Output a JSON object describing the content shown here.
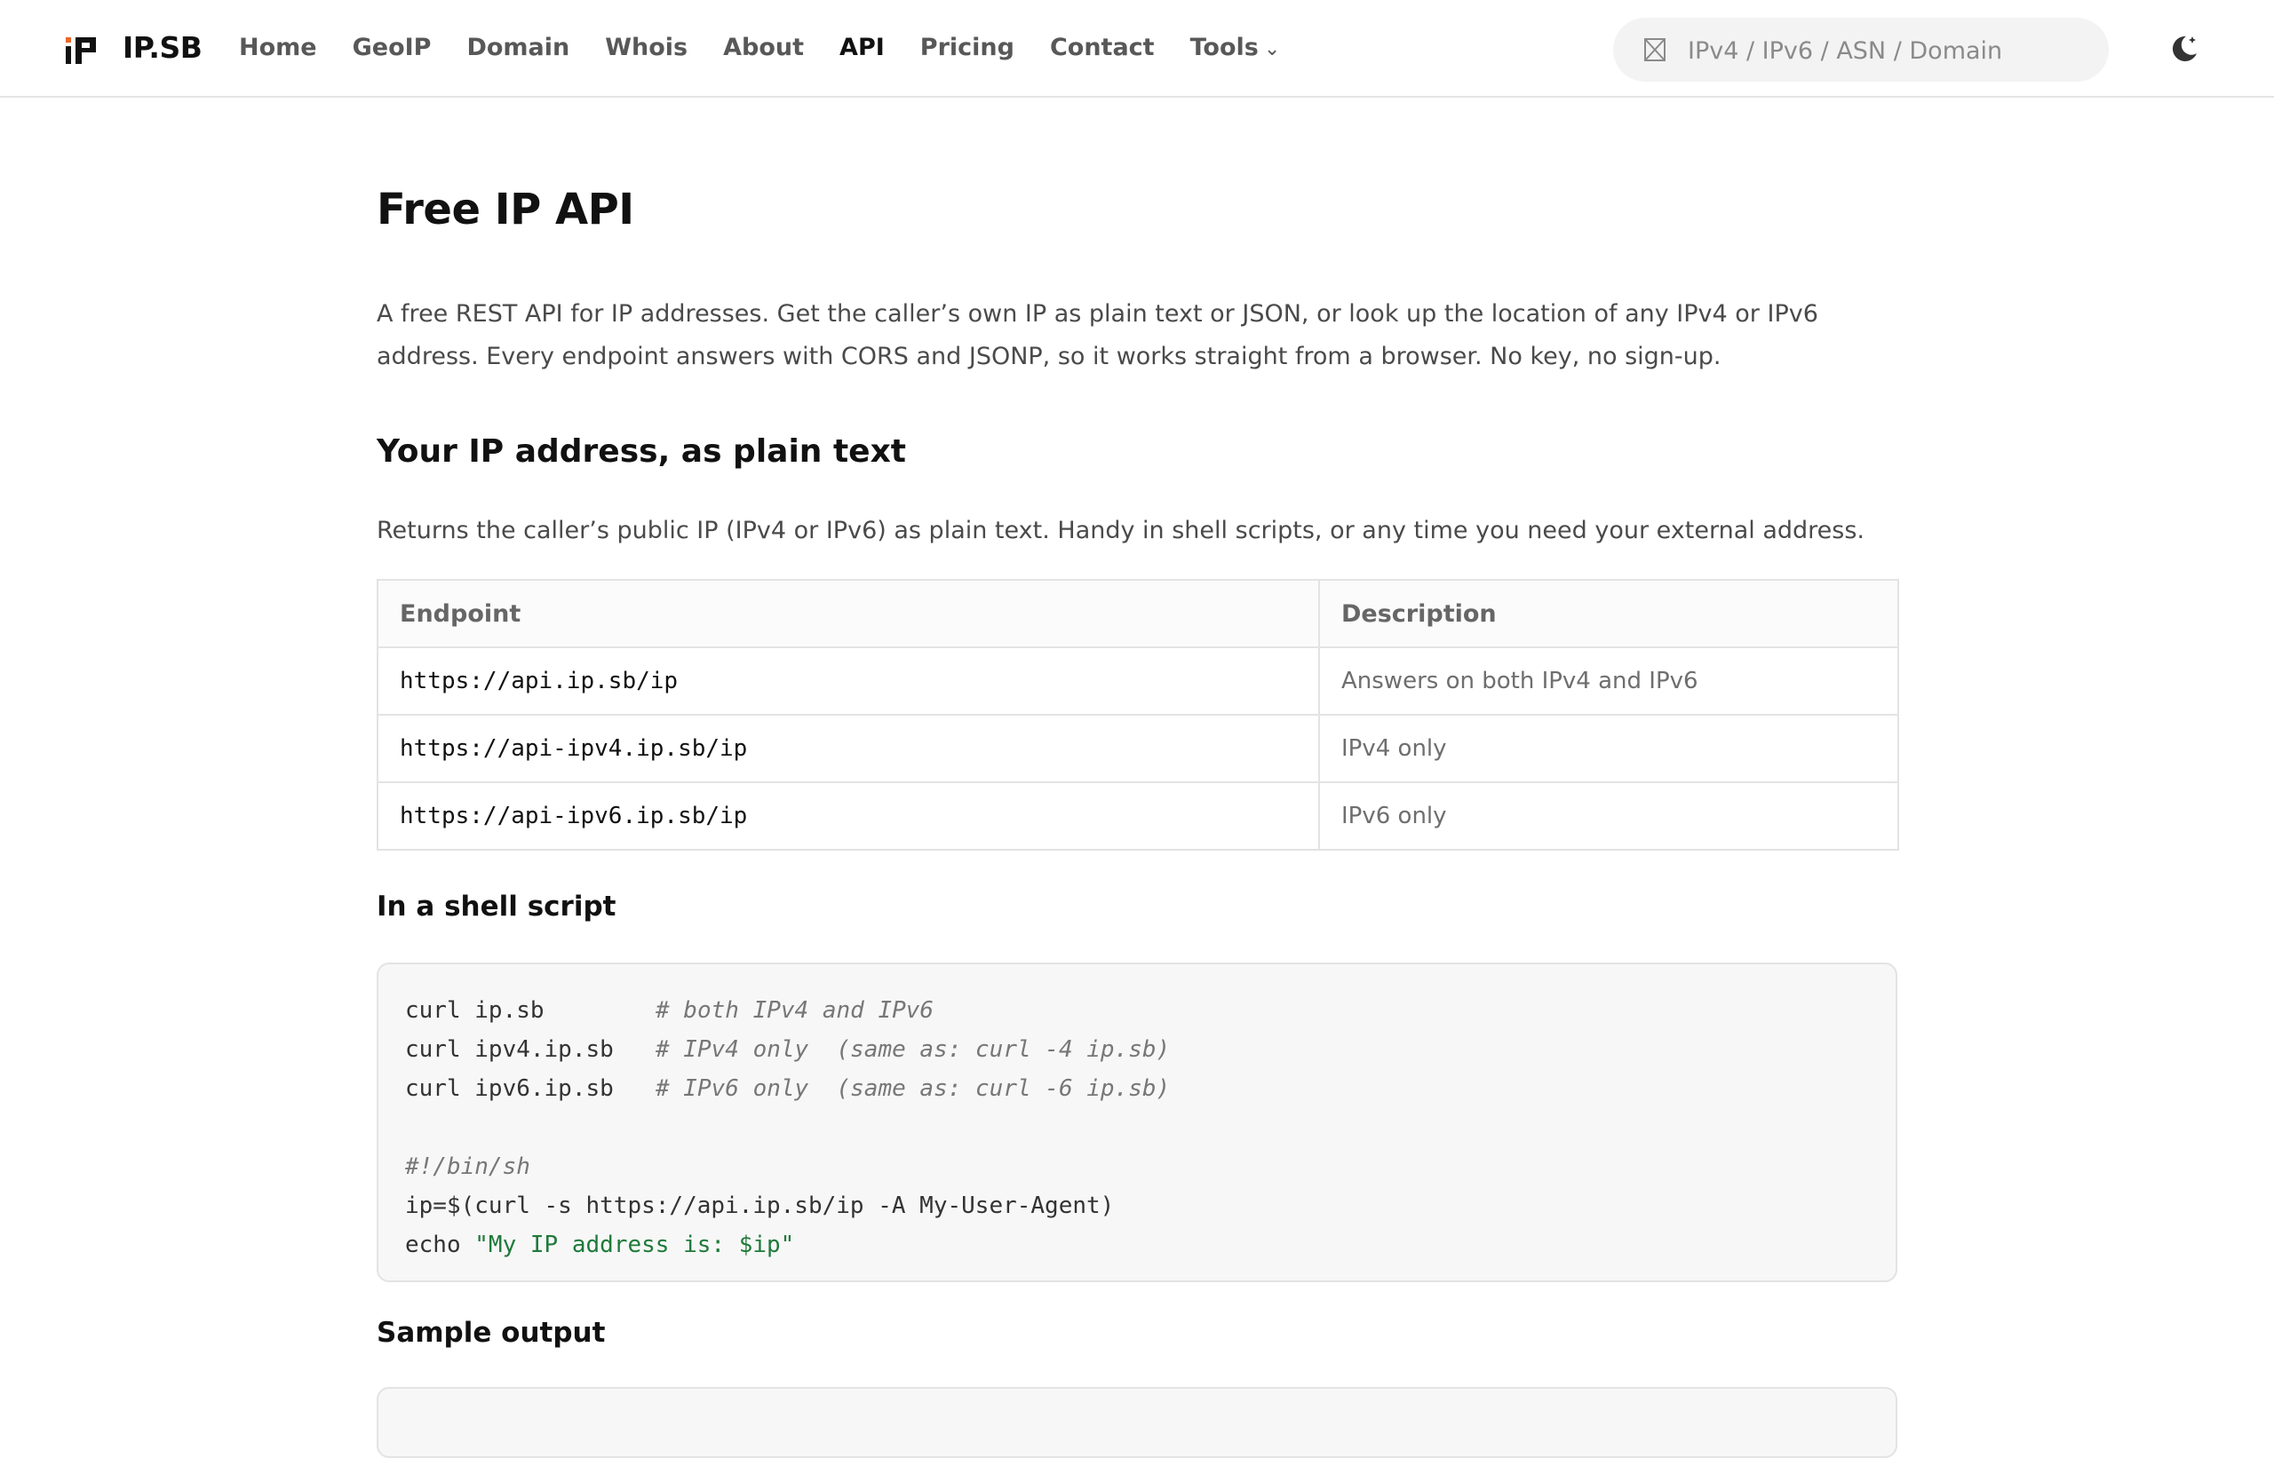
{
  "header": {
    "logo_text": "IP.SB",
    "nav": [
      {
        "label": "Home"
      },
      {
        "label": "GeoIP"
      },
      {
        "label": "Domain"
      },
      {
        "label": "Whois"
      },
      {
        "label": "About"
      },
      {
        "label": "API",
        "active": true
      },
      {
        "label": "Pricing"
      },
      {
        "label": "Contact"
      },
      {
        "label": "Tools",
        "has_dropdown": true
      }
    ],
    "search": {
      "placeholder": "IPv4 / IPv6 / ASN / Domain",
      "value": "",
      "icon": "search-icon"
    },
    "theme_toggle_icon": "moon-icon"
  },
  "page": {
    "title": "Free IP API",
    "intro": "A free REST API for IP addresses. Get the caller’s own IP as plain text or JSON, or look up the location of any IPv4 or IPv6 address. Every endpoint answers with CORS and JSONP, so it works straight from a browser. No key, no sign-up."
  },
  "section_plain": {
    "heading": "Your IP address, as plain text",
    "description": "Returns the caller’s public IP (IPv4 or IPv6) as plain text. Handy in shell scripts, or any time you need your external address.",
    "table": {
      "headers": [
        "Endpoint",
        "Description"
      ],
      "rows": [
        {
          "endpoint": "https://api.ip.sb/ip",
          "description": "Answers on both IPv4 and IPv6"
        },
        {
          "endpoint": "https://api-ipv4.ip.sb/ip",
          "description": "IPv4 only"
        },
        {
          "endpoint": "https://api-ipv6.ip.sb/ip",
          "description": "IPv6 only"
        }
      ]
    },
    "shell_heading": "In a shell script",
    "shell_code": {
      "line1_cmd": "curl ip.sb",
      "line1_comment": "# both IPv4 and IPv6",
      "line2_cmd": "curl ipv4.ip.sb",
      "line2_comment": "# IPv4 only  (same as: curl -4 ip.sb)",
      "line3_cmd": "curl ipv6.ip.sb",
      "line3_comment": "# IPv6 only  (same as: curl -6 ip.sb)",
      "line5_comment": "#!/bin/sh",
      "line6": "ip=$(curl -s https://api.ip.sb/ip -A My-User-Agent)",
      "line7_cmd": "echo ",
      "line7_string": "\"My IP address is: $ip\""
    },
    "sample_heading": "Sample output"
  },
  "colors": {
    "accent_orange": "#e8672c",
    "text_primary": "#111111",
    "text_muted": "#4a4a4a",
    "code_comment": "#777777",
    "code_string": "#1f7a3a",
    "code_bg": "#f7f7f7",
    "border": "#e3e3e3"
  }
}
